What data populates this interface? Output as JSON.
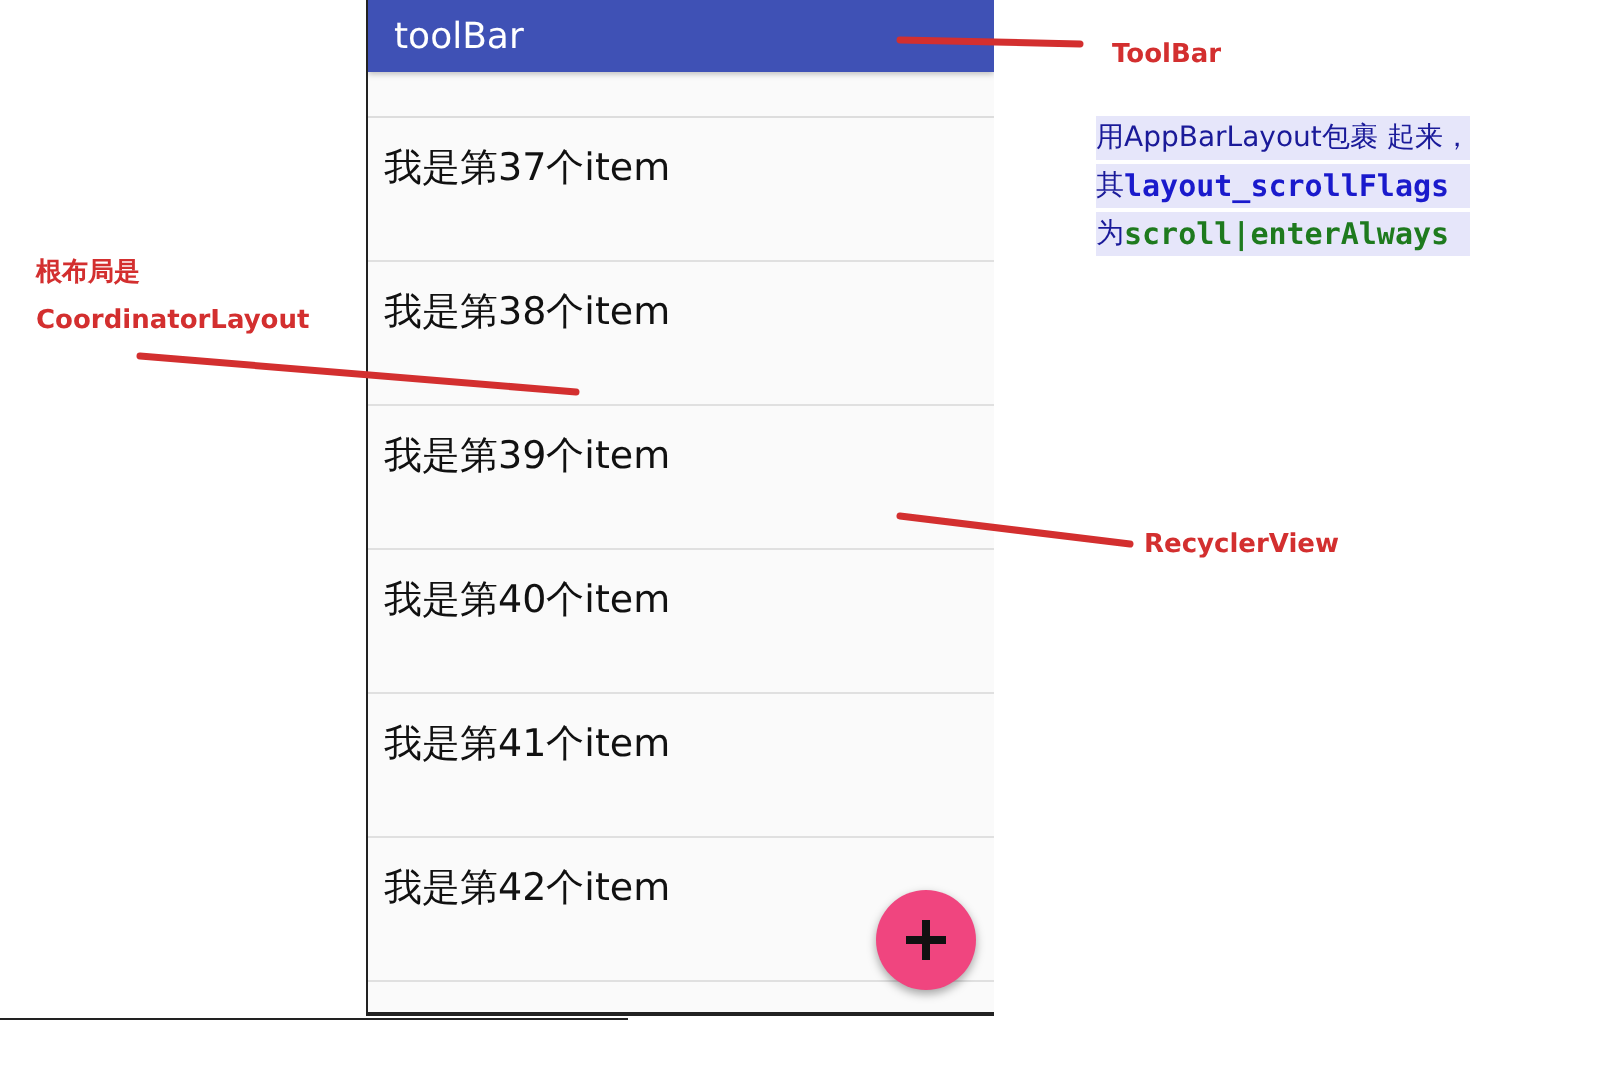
{
  "phone": {
    "toolbar": {
      "title": "toolBar"
    },
    "items": [
      "我是第37个item",
      "我是第38个item",
      "我是第39个item",
      "我是第40个item",
      "我是第41个item",
      "我是第42个item"
    ]
  },
  "annotations": [
    {
      "lines": [
        "ToolBar"
      ]
    },
    {
      "lines": [
        "根布局是",
        "CoordinatorLayout"
      ]
    },
    {
      "lines": [
        "RecyclerView"
      ]
    }
  ],
  "note": {
    "lines": [
      [
        {
          "kind": "plain",
          "text": "用AppBarLayout包裹 起来，"
        }
      ],
      [
        {
          "kind": "plain",
          "text": "其"
        },
        {
          "kind": "key",
          "text": "layout_scrollFlags"
        }
      ],
      [
        {
          "kind": "plain",
          "text": "为"
        },
        {
          "kind": "value",
          "text": "scroll|enterAlways"
        }
      ]
    ]
  }
}
